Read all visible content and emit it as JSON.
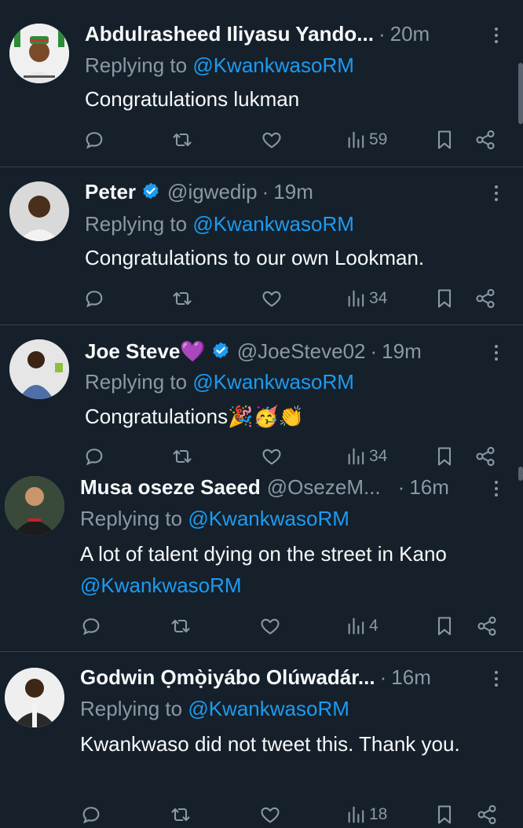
{
  "replying_label": "Replying to",
  "tweets": [
    {
      "name": "Abdulrasheed Iliyasu Yando...",
      "handle": "",
      "time": "20m",
      "verified": false,
      "reply_to": "@KwankwasoRM",
      "text": "Congratulations lukman",
      "views": "59"
    },
    {
      "name": "Peter",
      "handle": "@igwedip",
      "time": "19m",
      "verified": true,
      "reply_to": "@KwankwasoRM",
      "text": "Congratulations to our own Lookman.",
      "views": "34"
    },
    {
      "name": "Joe Steve",
      "name_emoji": "💜",
      "handle": "@JoeSteve02",
      "time": "19m",
      "verified": true,
      "reply_to": "@KwankwasoRM",
      "text": "Congratulations🎉🥳👏",
      "views": "34"
    },
    {
      "name": "Musa oseze Saeed",
      "handle": "@OsezeM...",
      "time": "16m",
      "verified": false,
      "reply_to": "@KwankwasoRM",
      "text": "A lot of talent dying on the street in Kano",
      "text_mention": "@KwankwasoRM",
      "views": "4"
    },
    {
      "name": "Godwin Ọmọ̀iyábo Olúwadár...",
      "handle": "",
      "time": "16m",
      "verified": false,
      "reply_to": "@KwankwasoRM",
      "text": "Kwankwaso did not tweet this. Thank you.",
      "views": "18"
    }
  ],
  "icons": {
    "reply": "reply-icon",
    "retweet": "retweet-icon",
    "like": "heart-icon",
    "views": "views-icon",
    "bookmark": "bookmark-icon",
    "share": "share-icon",
    "more": "more-icon",
    "verified": "verified-badge-icon"
  },
  "colors": {
    "background": "#15202b",
    "accent": "#1d9bf0",
    "secondary_text": "#8b98a5",
    "divider": "#38444d"
  }
}
